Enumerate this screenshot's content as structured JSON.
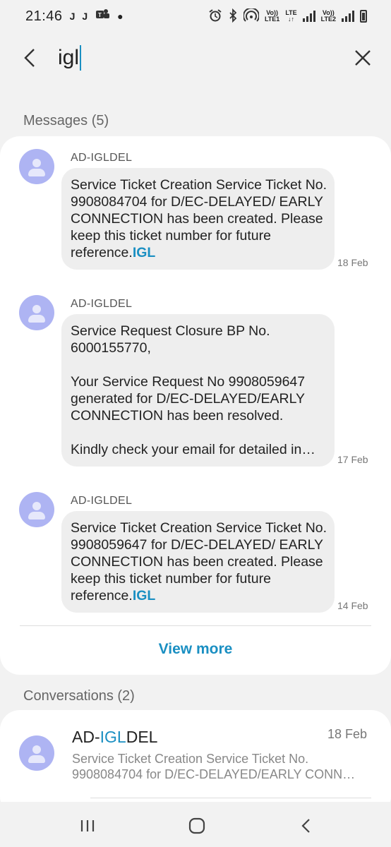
{
  "status_bar": {
    "time": "21:46",
    "notifications": [
      "J",
      "J",
      "teams"
    ],
    "net1": "Vo)) LTE\nLTE1",
    "net2": "Vo))\nLTE2",
    "lte_label": "LTE",
    "vo_label_1": "Vo))",
    "lte1_label": "LTE1",
    "vo_label_2": "Vo))",
    "lte2_label": "LTE2"
  },
  "search": {
    "query": "igl",
    "back_icon": "back-arrow-icon",
    "close_icon": "close-icon"
  },
  "messages_section": {
    "header": "Messages (5)",
    "items": [
      {
        "sender": "AD-IGLDEL",
        "text": "Service Ticket Creation Service Ticket No. 9908084704 for D/EC-DELAYED/ EARLY CONNECTION has been created. Please keep this ticket number for future reference.",
        "highlight": "IGL",
        "date": "18 Feb"
      },
      {
        "sender": "AD-IGLDEL",
        "text": "Service Request Closure BP No. 6000155770,\n\nYour Service Request No 9908059647 generated for D/EC-DELAYED/EARLY CONNECTION has been resolved.\n\nKindly check your email for detailed in…",
        "highlight": "",
        "date": "17 Feb"
      },
      {
        "sender": "AD-IGLDEL",
        "text": "Service Ticket Creation Service Ticket No. 9908059647 for D/EC-DELAYED/ EARLY CONNECTION has been created. Please keep this ticket number for future reference.",
        "highlight": "IGL",
        "date": "14 Feb"
      }
    ],
    "view_more": "View more"
  },
  "conversations_section": {
    "header": "Conversations (2)",
    "items": [
      {
        "name_prefix": "AD-",
        "name_highlight": "IGL",
        "name_suffix": "DEL",
        "date": "18 Feb",
        "preview": "Service Ticket Creation Service Ticket No. 9908084704 for D/EC-DELAYED/EARLY CONN…"
      }
    ]
  },
  "colors": {
    "accent": "#1a8fc2",
    "avatar": "#aeb4f3",
    "bubble": "#eeeeee",
    "background": "#f2f2f2"
  },
  "nav_bar": {
    "icons": [
      "recent-apps-icon",
      "home-icon",
      "back-icon"
    ]
  }
}
